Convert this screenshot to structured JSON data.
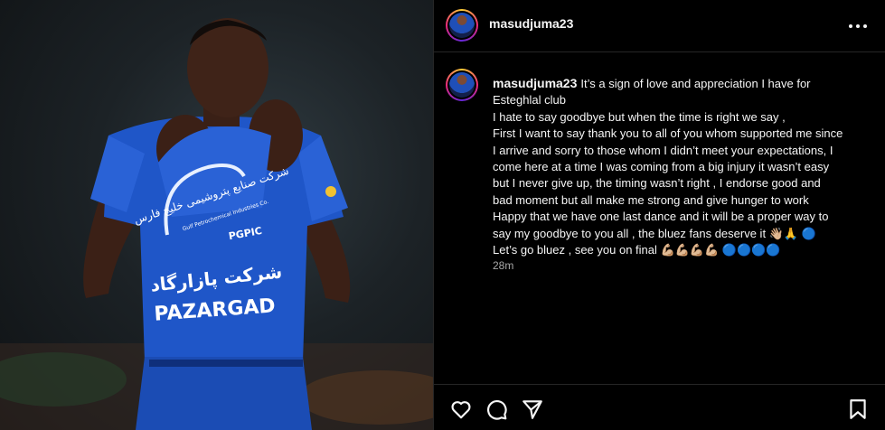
{
  "post": {
    "username": "masudjuma23",
    "image_alt": "Player in blue Esteghlal jersey covering his face",
    "jersey": {
      "sponsor_fa_top": "شرکت صنایع پتروشیمی خلیج فارس",
      "sponsor_en_small": "Gulf Petrochemical Industries Co.",
      "sponsor_abbr": "PGPIC",
      "brand_fa": "شرکت پازارگاد",
      "brand_en": "PAZARGAD"
    },
    "caption": {
      "lines": [
        "It’s a sign of love and appreciation I have for",
        "Esteghlal club",
        "I hate to say goodbye but when the time is right we say ,",
        "First I want to say thank you to all of you whom supported me since",
        "I arrive and sorry to those whom I didn’t meet your expectations, I",
        "come here at a time I was coming from a big injury it wasn’t easy",
        "but I never give up, the timing wasn’t right , I endorse good and",
        "bad moment but all make me strong and give hunger to work",
        "Happy that we have one last dance and it will be a proper way to",
        "say my goodbye to you all , the bluez fans deserve it 👋🏼🙏 🔵",
        "Let’s go bluez , see you on final 💪🏼💪🏼💪🏼💪🏼 🔵🔵🔵🔵"
      ]
    },
    "timestamp": "28m"
  },
  "icons": {
    "more": "more-options-icon",
    "like": "heart-icon",
    "comment": "comment-icon",
    "share": "send-icon",
    "save": "bookmark-icon"
  },
  "colors": {
    "background": "#000000",
    "text": "#f5f5f5",
    "muted": "#a8a8a8",
    "jersey_blue": "#1f56c8",
    "story_ring": [
      "#f9ce34",
      "#ee2a7b",
      "#6228d7"
    ]
  }
}
